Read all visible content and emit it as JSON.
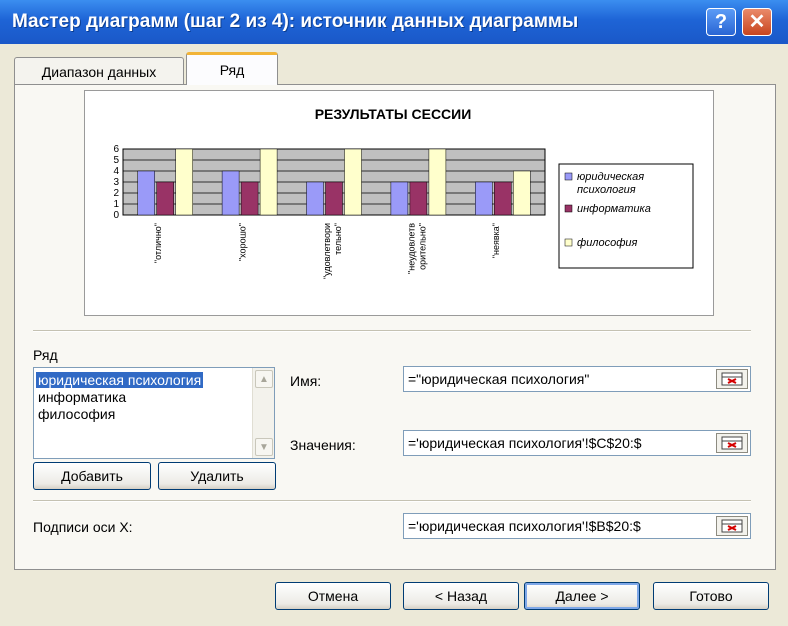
{
  "window": {
    "title": "Мастер диаграмм (шаг 2 из 4): источник данных диаграммы",
    "help_label": "?",
    "close_label": "✕"
  },
  "tabs": [
    {
      "label": "Диапазон данных"
    },
    {
      "label": "Ряд"
    }
  ],
  "chart_data": {
    "type": "bar",
    "title": "РЕЗУЛЬТАТЫ СЕССИИ",
    "categories": [
      "\"отлично\"",
      "\"хорошо\"",
      "\"удовлетвори тельно\"",
      "\"неудовлетв орительно\"",
      "\"неявка\""
    ],
    "series": [
      {
        "name": "юридическая психология",
        "values": [
          4,
          4,
          3,
          3,
          3
        ]
      },
      {
        "name": "информатика",
        "values": [
          3,
          3,
          3,
          3,
          3
        ]
      },
      {
        "name": "философия",
        "values": [
          6,
          6,
          6,
          6,
          4
        ]
      }
    ],
    "yticks": [
      "0",
      "1",
      "2",
      "3",
      "4",
      "5",
      "6"
    ],
    "ylim": [
      0,
      6
    ],
    "grid": true,
    "legend_position": "right",
    "colors": [
      "#9a9af8",
      "#993366",
      "#ffffcc"
    ],
    "plot_background": "#c0c0c0"
  },
  "series_section": {
    "label": "Ряд",
    "items": [
      "юридическая психология",
      "информатика",
      "философия"
    ],
    "selected_index": 0,
    "add_label": "Добавить",
    "remove_label": "Удалить"
  },
  "fields": {
    "name_label": "Имя:",
    "name_value": "=\"юридическая психология\"",
    "values_label": "Значения:",
    "values_value": "='юридическая психология'!$C$20:$",
    "xlabels_label": "Подписи оси X:",
    "xlabels_value": "='юридическая психология'!$B$20:$"
  },
  "footer": {
    "cancel_label": "Отмена",
    "back_label": "< Назад",
    "next_label": "Далее >",
    "finish_label": "Готово"
  }
}
